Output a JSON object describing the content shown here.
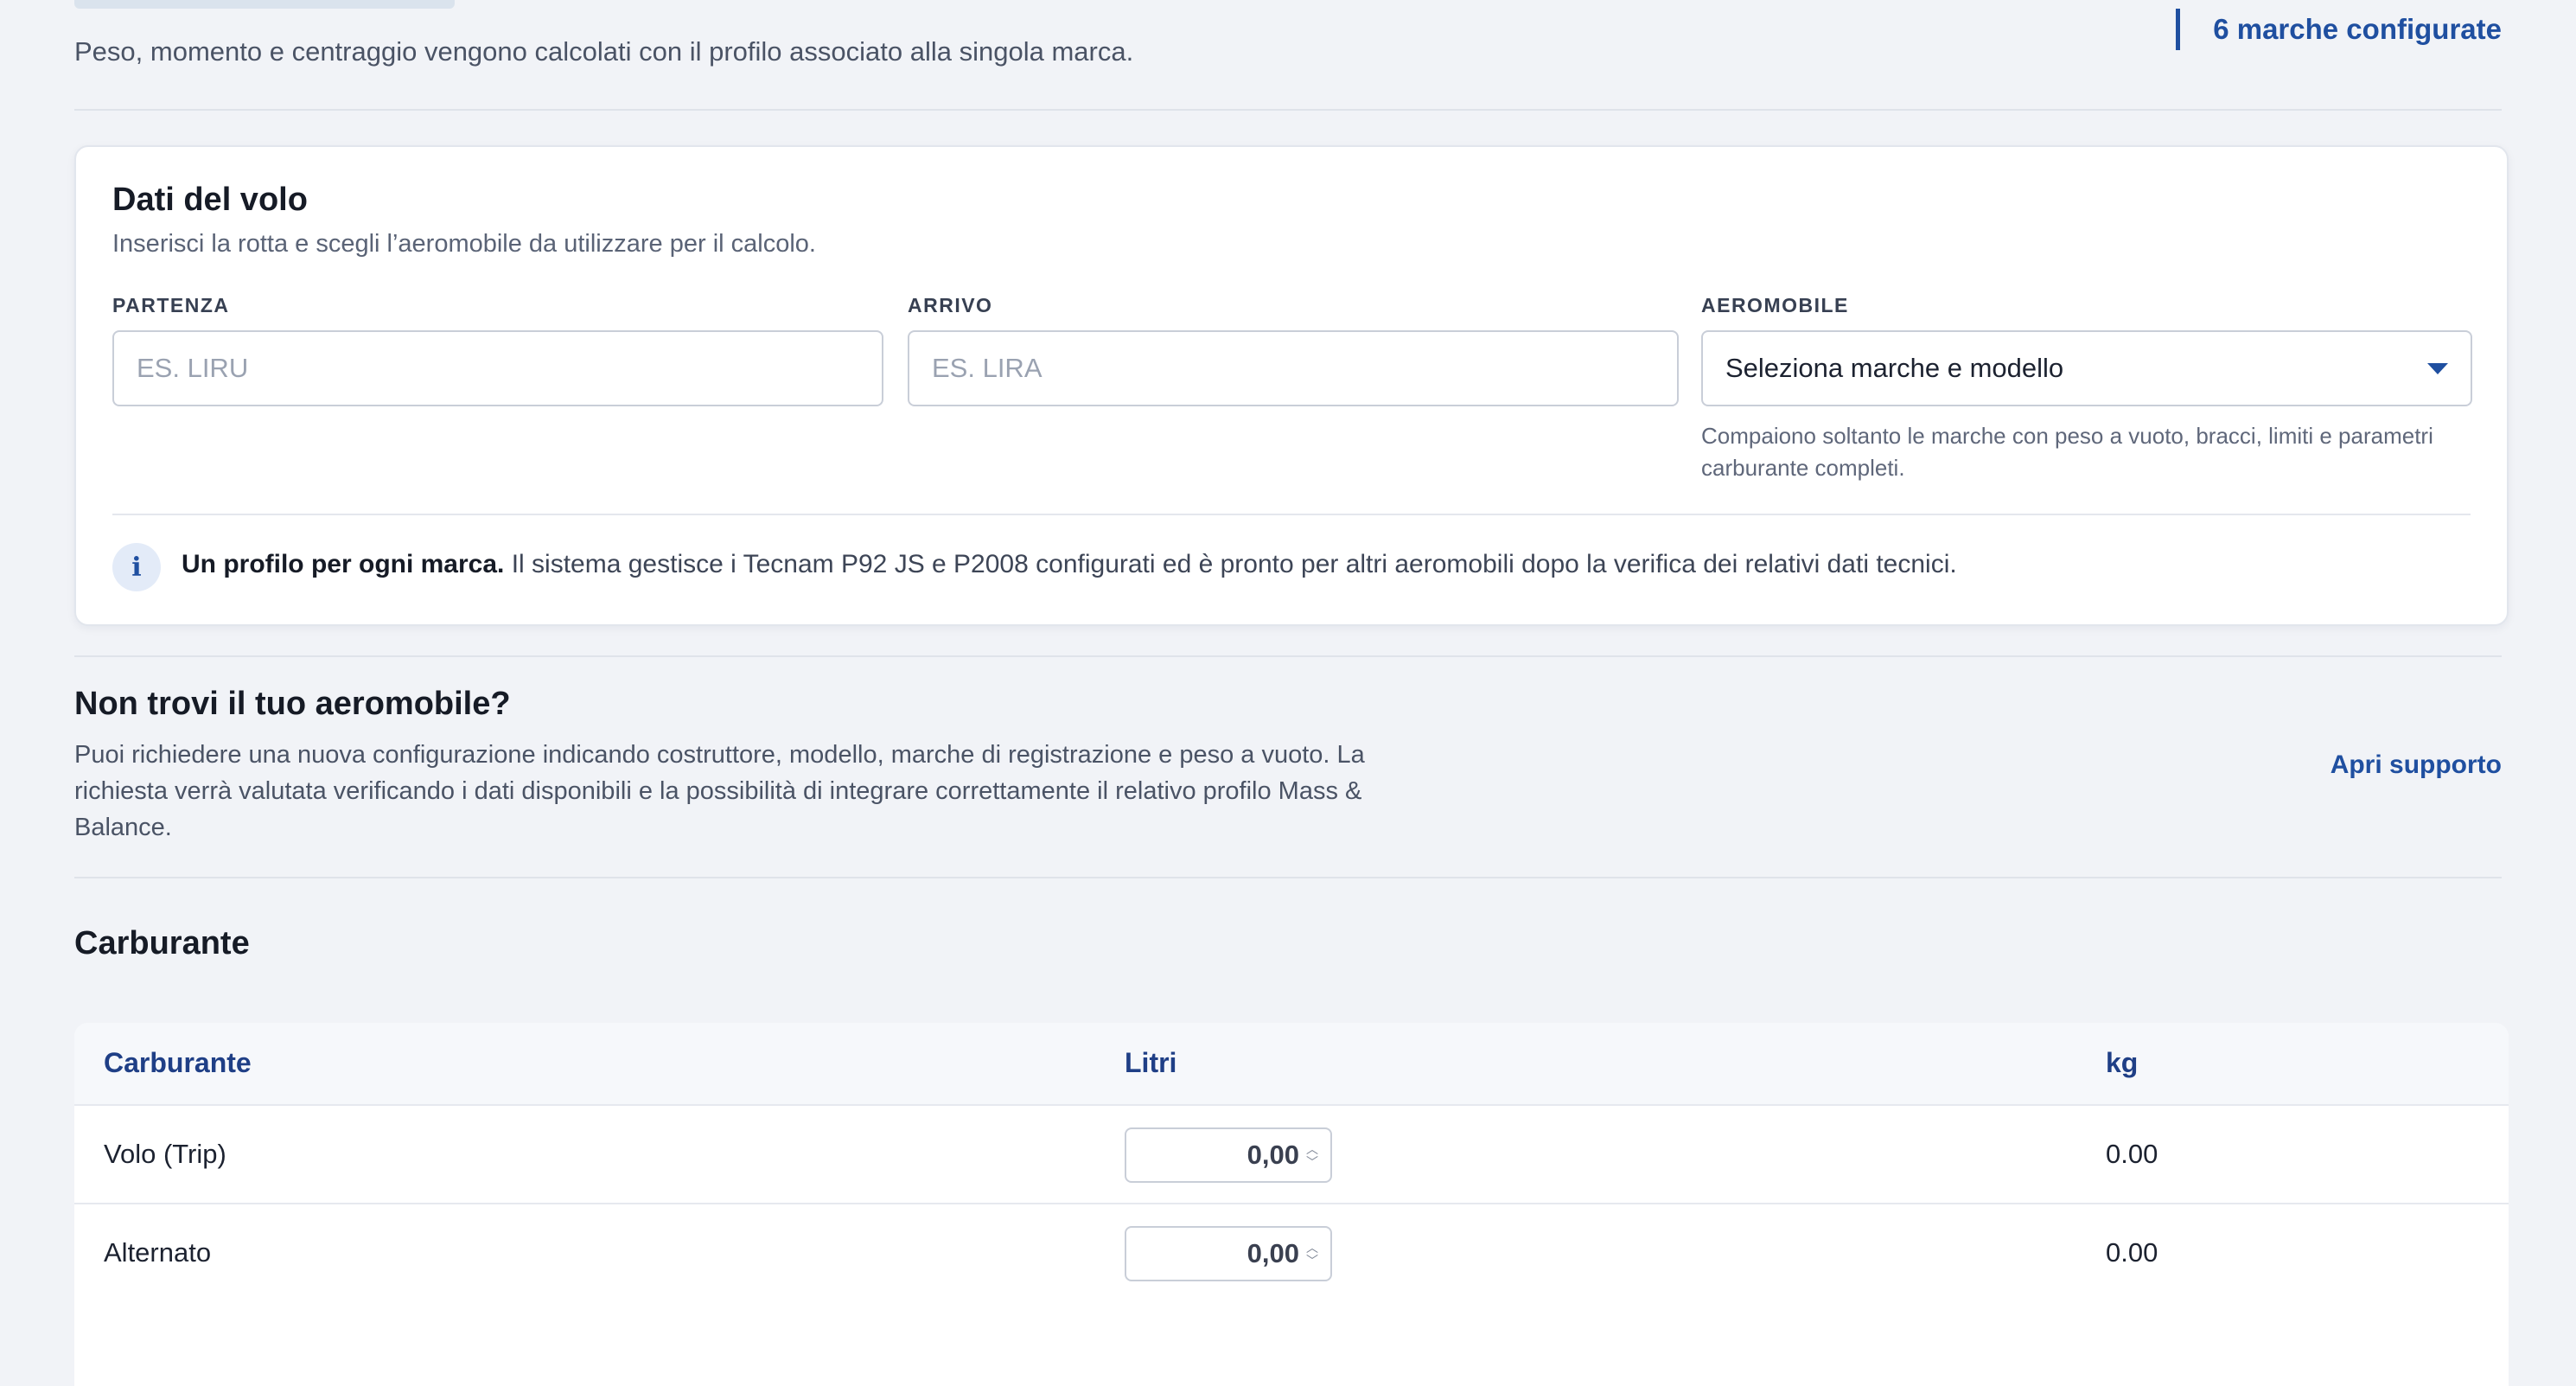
{
  "header": {
    "subtitle": "Peso, momento e centraggio vengono calcolati con il profilo associato alla singola marca.",
    "configured_count": "6 marche configurate"
  },
  "flight": {
    "title": "Dati del volo",
    "subtitle": "Inserisci la rotta e scegli l’aeromobile da utilizzare per il calcolo.",
    "departure_label": "PARTENZA",
    "departure_placeholder": "ES. LIRU",
    "arrival_label": "ARRIVO",
    "arrival_placeholder": "ES. LIRA",
    "aircraft_label": "AEROMOBILE",
    "aircraft_selected": "Seleziona marche e modello",
    "aircraft_help": "Compaiono soltanto le marche con peso a vuoto, bracci, limiti e parametri carburante completi.",
    "info_icon": "info-icon",
    "info_bold": "Un profilo per ogni marca.",
    "info_text": "Il sistema gestisce i Tecnam P92 JS e P2008 configurati ed è pronto per altri aeromobili dopo la verifica dei relativi dati tecnici."
  },
  "support": {
    "title": "Non trovi il tuo aeromobile?",
    "text": "Puoi richiedere una nuova configurazione indicando costruttore, modello, marche di registrazione e peso a vuoto. La richiesta verrà valutata verificando i dati disponibili e la possibilità di integrare correttamente il relativo profilo Mass & Balance.",
    "link": "Apri supporto"
  },
  "fuel": {
    "title": "Carburante",
    "columns": [
      "Carburante",
      "Litri",
      "kg"
    ],
    "rows": [
      {
        "name": "Volo (Trip)",
        "litri": "0,00",
        "kg": "0.00"
      },
      {
        "name": "Alternato",
        "litri": "0,00",
        "kg": "0.00"
      }
    ]
  },
  "colors": {
    "accent": "#1f4fa0",
    "background": "#f1f3f7",
    "table_header_text": "#1f3f86"
  }
}
